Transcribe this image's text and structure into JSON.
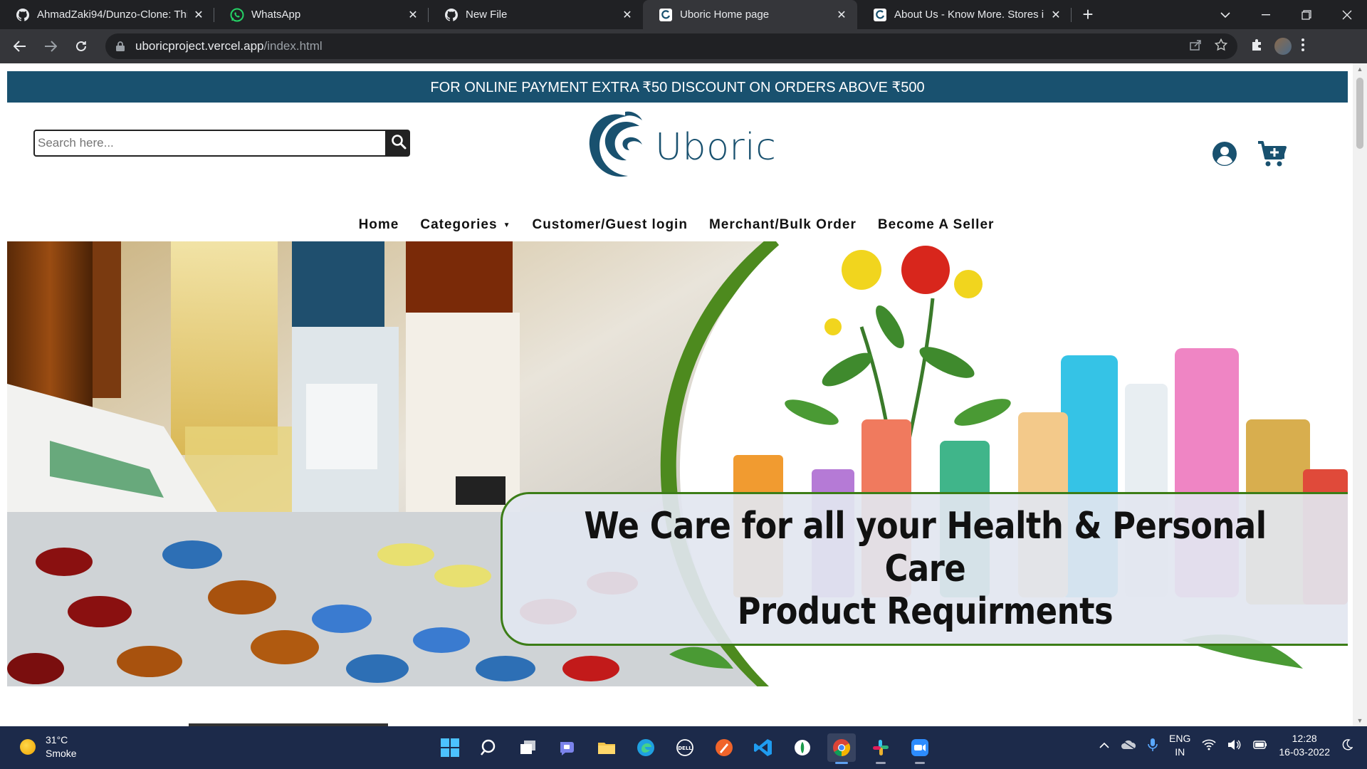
{
  "browser": {
    "tabs": [
      {
        "title": "AhmadZaki94/Dunzo-Clone: This",
        "icon": "github-icon",
        "active": false
      },
      {
        "title": "WhatsApp",
        "icon": "whatsapp-icon",
        "active": false
      },
      {
        "title": "New File",
        "icon": "github-icon",
        "active": false
      },
      {
        "title": "Uboric Home page",
        "icon": "uboric-favicon-icon",
        "active": true
      },
      {
        "title": "About Us - Know More. Stores in",
        "icon": "uboric-favicon-icon",
        "active": false
      }
    ],
    "new_tab_label": "+",
    "address": {
      "host": "uboricproject.vercel.app",
      "path": "/index.html"
    }
  },
  "page": {
    "promo_banner": "FOR ONLINE PAYMENT EXTRA ₹50 DISCOUNT ON ORDERS ABOVE ₹500",
    "search": {
      "placeholder": "Search here..."
    },
    "logo_text": "Uboric",
    "nav": [
      {
        "label": "Home"
      },
      {
        "label": "Categories"
      },
      {
        "label": "Customer/Guest login"
      },
      {
        "label": "Merchant/Bulk Order"
      },
      {
        "label": "Become A Seller"
      }
    ],
    "hero": {
      "caption_line1": "We Care for all your Health & Personal Care",
      "caption_line2": "Product Requirments"
    }
  },
  "taskbar": {
    "weather_temp": "31°C",
    "weather_desc": "Smoke",
    "language_top": "ENG",
    "language_bottom": "IN",
    "time": "12:28",
    "date": "16-03-2022"
  },
  "colors": {
    "brand": "#19516f",
    "banner_bg": "#19516f",
    "hero_border": "#3c7d17",
    "taskbar_bg": "#1c2a4a"
  }
}
